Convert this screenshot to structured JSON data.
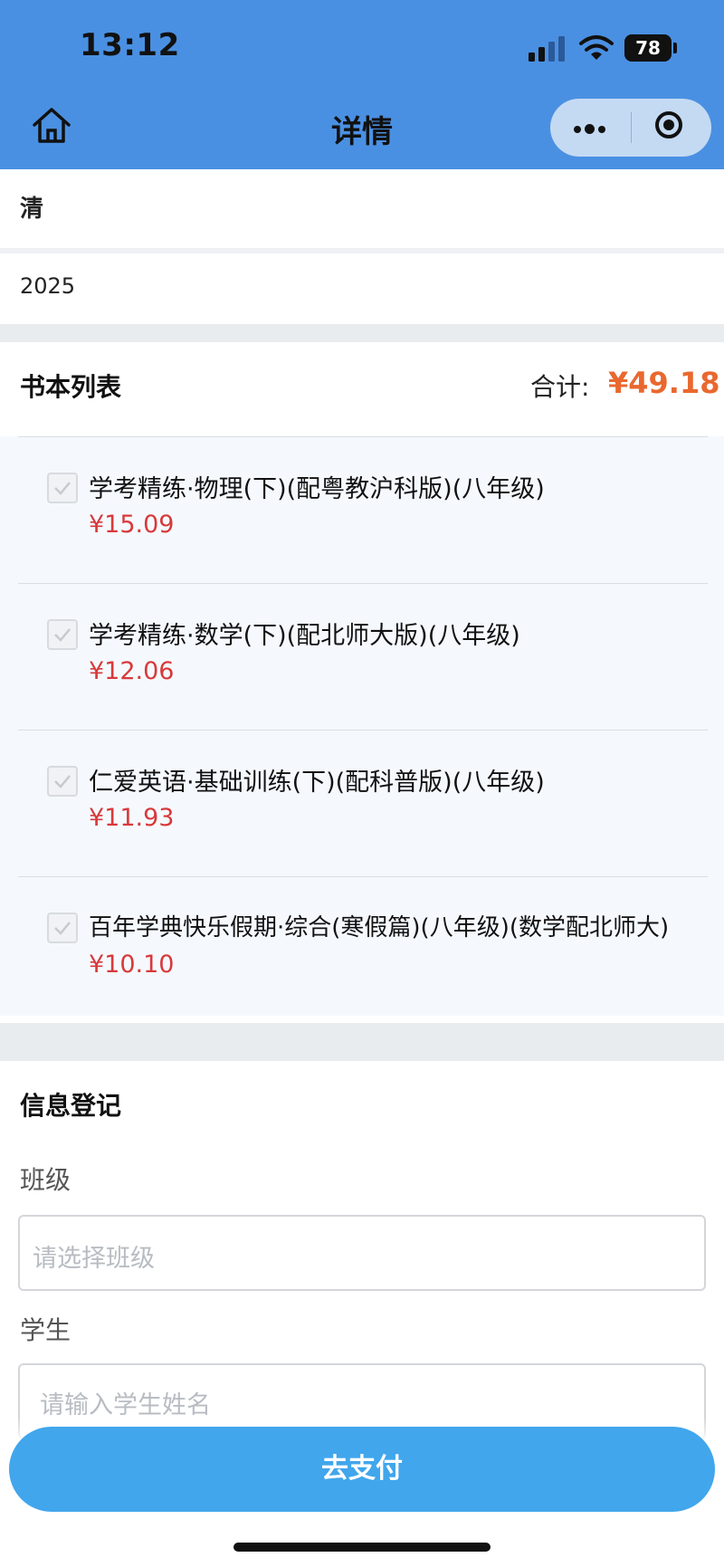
{
  "status_bar": {
    "time": "13:12",
    "battery": "78"
  },
  "nav": {
    "title": "详情",
    "home_icon": "home-icon",
    "more_icon": "more-dots-icon",
    "close_icon": "target-close-icon"
  },
  "header": {
    "school_line": "清",
    "list_line": "2025"
  },
  "books": {
    "heading": "书本列表",
    "total_label": "合计:",
    "total_value": "¥49.18",
    "items": [
      {
        "name": "学考精练·物理(下)(配粤教沪科版)(八年级)",
        "price": "¥15.09",
        "checked": true
      },
      {
        "name": "学考精练·数学(下)(配北师大版)(八年级)",
        "price": "¥12.06",
        "checked": true
      },
      {
        "name": "仁爱英语·基础训练(下)(配科普版)(八年级)",
        "price": "¥11.93",
        "checked": true
      },
      {
        "name": "百年学典快乐假期·综合(寒假篇)(八年级)(数学配北师大)",
        "price": "¥10.10",
        "checked": true
      }
    ]
  },
  "form": {
    "heading": "信息登记",
    "class_label": "班级",
    "class_placeholder": "请选择班级",
    "student_label": "学生",
    "student_placeholder": "请输入学生姓名"
  },
  "pay_button": "去支付",
  "colors": {
    "nav_bg": "#4a90e2",
    "total": "#e9682f",
    "price": "#d8393b",
    "pay": "#41a6ec"
  }
}
